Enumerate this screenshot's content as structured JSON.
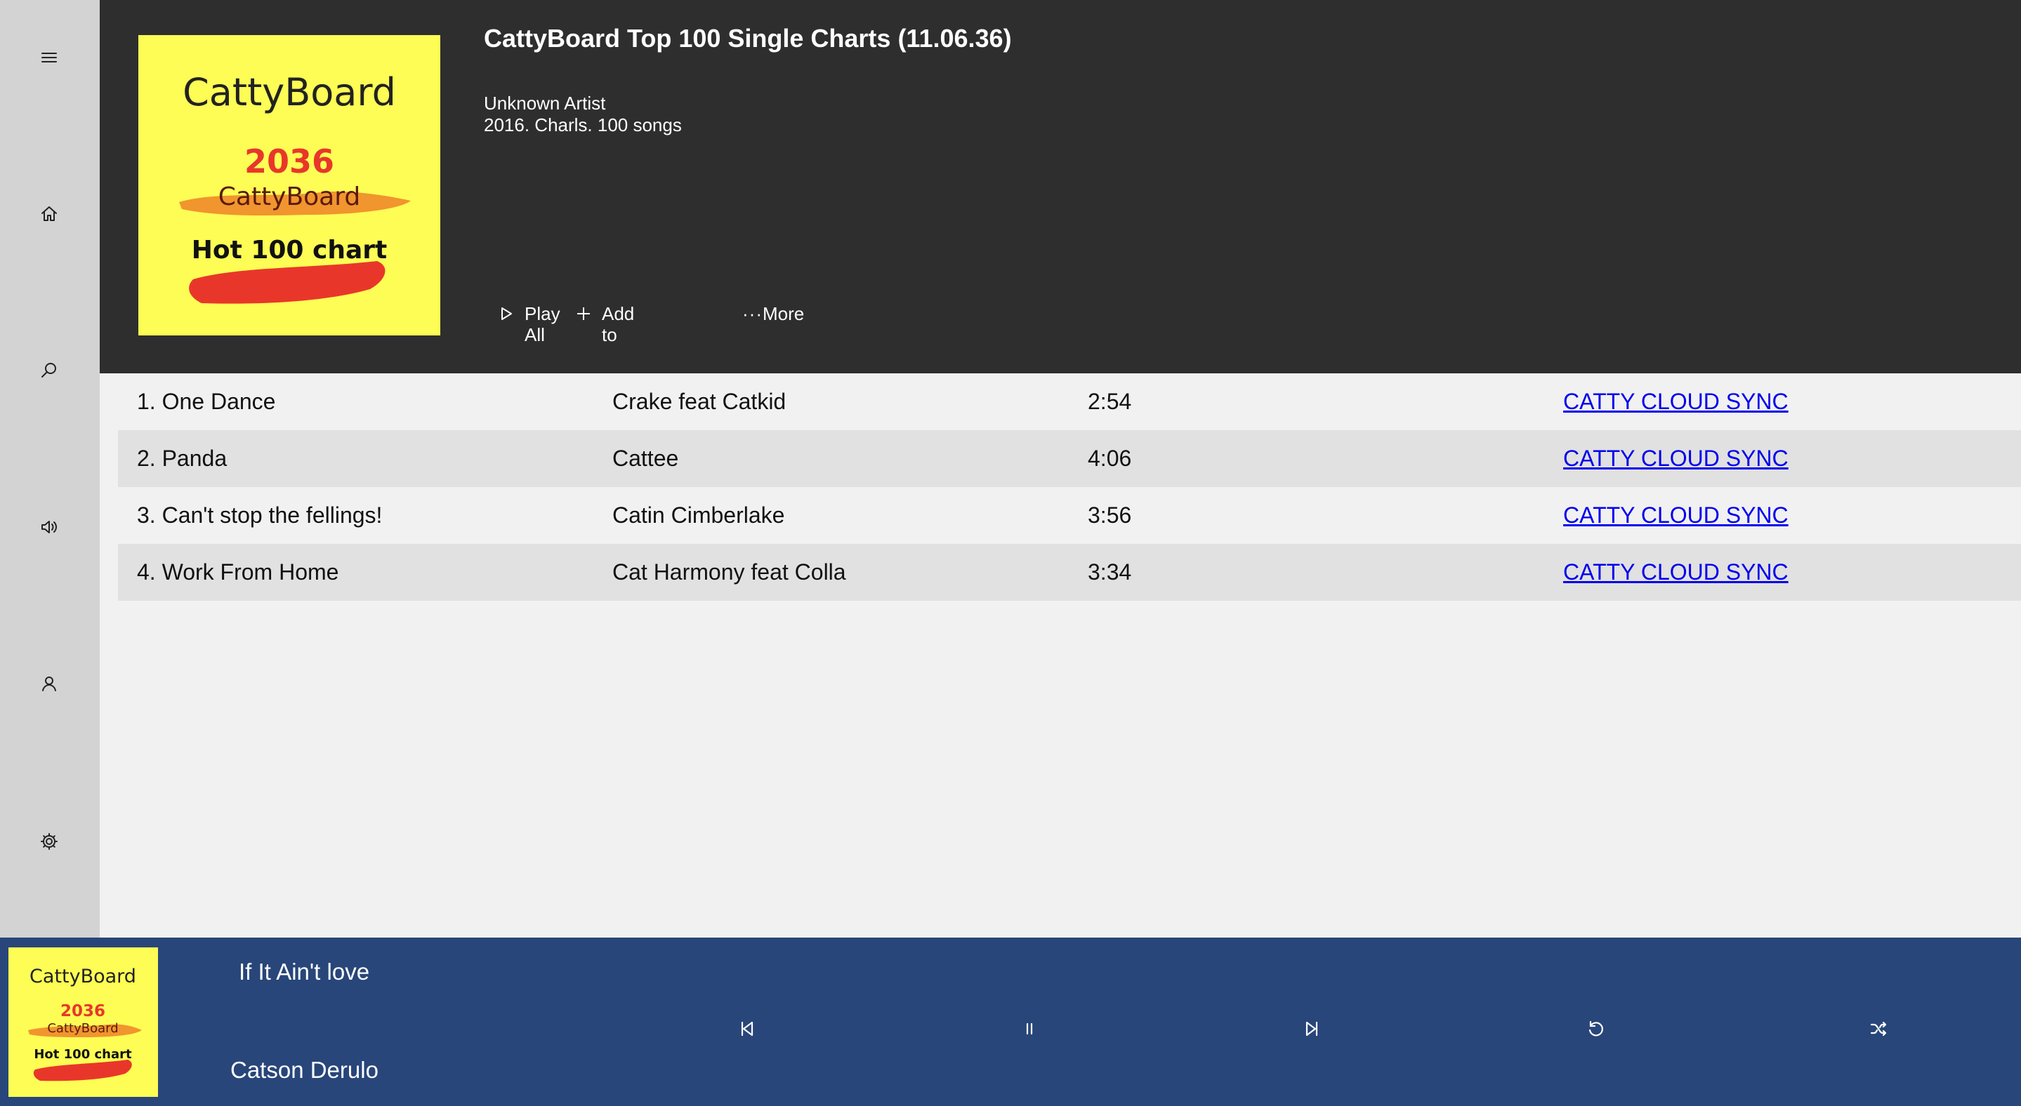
{
  "nav": {
    "items": [
      {
        "name": "menu",
        "icon": "hamburger-menu-icon"
      },
      {
        "name": "home",
        "icon": "home-icon"
      },
      {
        "name": "search",
        "icon": "search-icon"
      },
      {
        "name": "volume",
        "icon": "speaker-icon"
      },
      {
        "name": "account",
        "icon": "user-icon"
      },
      {
        "name": "settings",
        "icon": "gear-icon"
      }
    ]
  },
  "album": {
    "title": "CattyBoard Top 100 Single Charts (11.06.36)",
    "artist": "Unknown Artist",
    "details": "2016. Charls. 100 songs",
    "cover": {
      "brand": "CattyBoard",
      "year": "2036",
      "sub_brand": "CattyBoard",
      "caption": "Hot 100 chart"
    },
    "actions": {
      "play_all_line1": "Play",
      "play_all_line2": "All",
      "add_to_line1": "Add",
      "add_to_line2": "to",
      "more": "More"
    }
  },
  "tracks": [
    {
      "title": "1. One Dance",
      "artist": "Crake feat Catkid",
      "duration": "2:54",
      "link": "CATTY CLOUD SYNC"
    },
    {
      "title": "2. Panda",
      "artist": "Cattee",
      "duration": "4:06",
      "link": "CATTY CLOUD SYNC"
    },
    {
      "title": "3. Can't stop the fellings!",
      "artist": "Catin Cimberlake",
      "duration": "3:56",
      "link": "CATTY CLOUD SYNC"
    },
    {
      "title": "4. Work From Home",
      "artist": "Cat Harmony feat Colla",
      "duration": "3:34",
      "link": "CATTY CLOUD SYNC"
    }
  ],
  "player": {
    "song": "If It Ain't love",
    "artist": "Catson Derulo",
    "cover": {
      "brand": "CattyBoard",
      "year": "2036",
      "sub_brand": "CattyBoard",
      "caption": "Hot 100 chart"
    }
  },
  "colors": {
    "rail": "#d3d3d3",
    "header": "#2e2e2e",
    "cover_bg": "#fdfd55",
    "player": "#284679",
    "link": "#0000ee",
    "year_red": "#e8372a",
    "brush_orange": "#f08a2a"
  }
}
